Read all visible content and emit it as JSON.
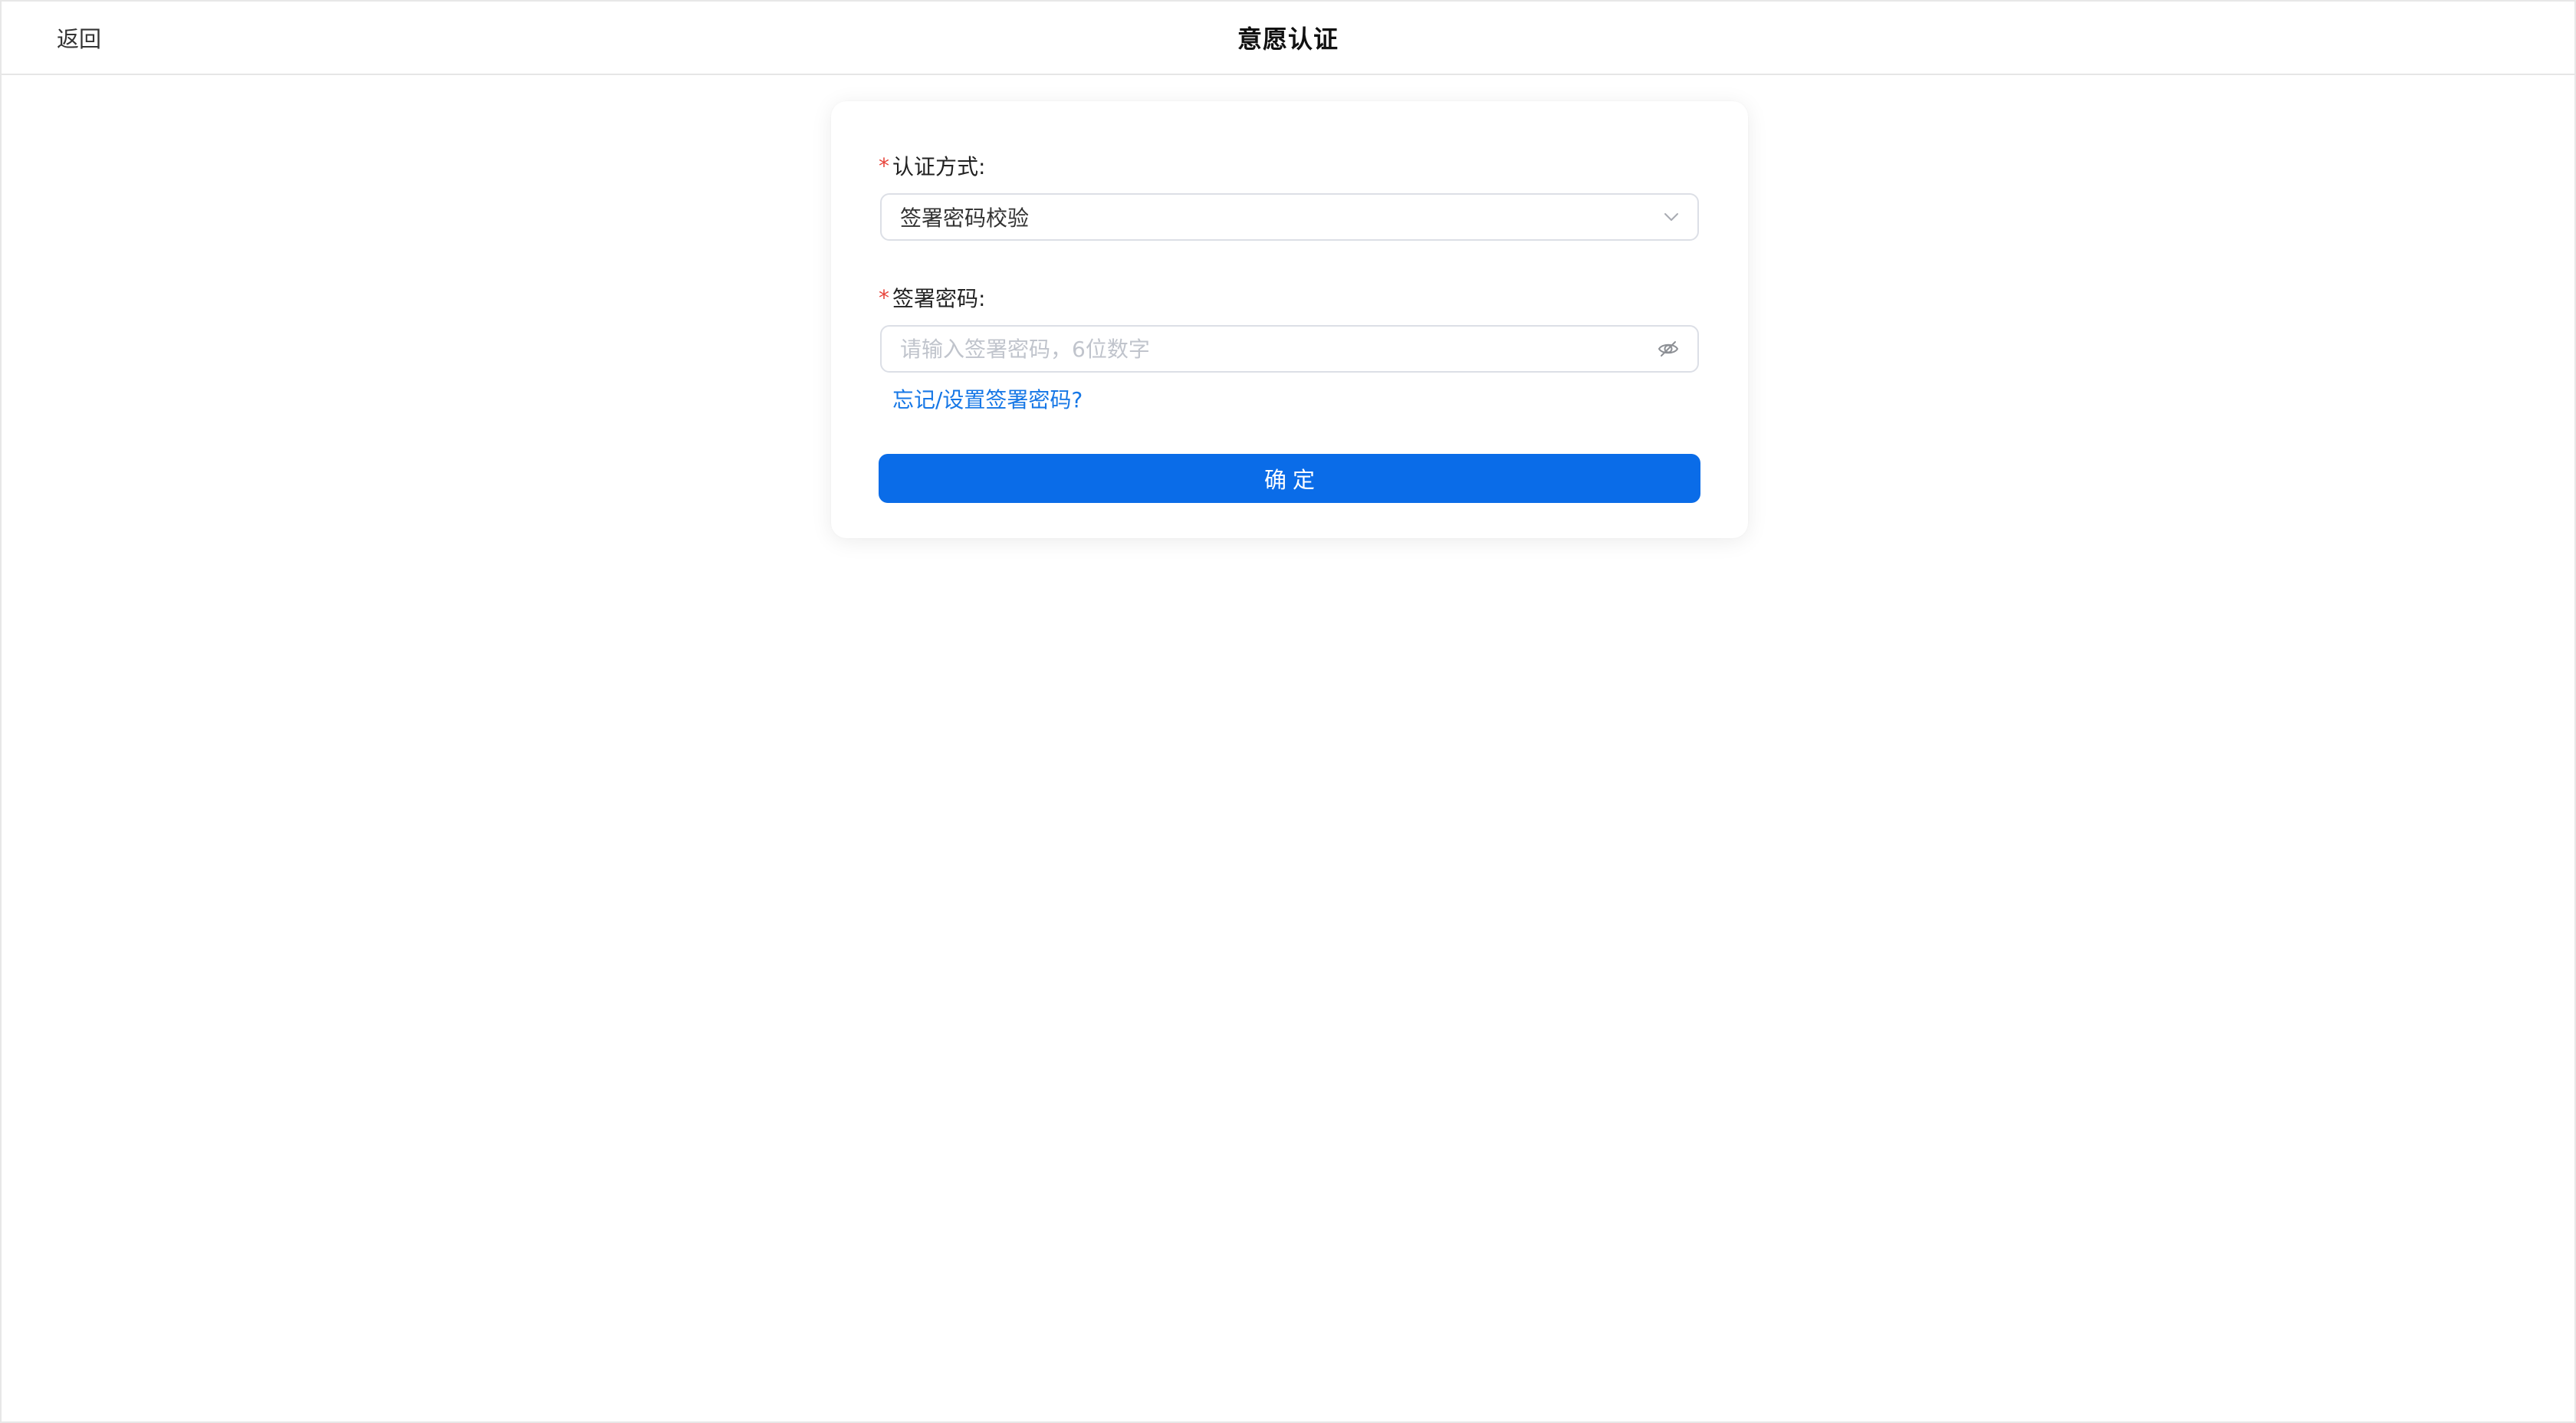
{
  "header": {
    "back_label": "返回",
    "title": "意愿认证"
  },
  "form": {
    "auth_method": {
      "required_mark": "*",
      "label": "认证方式:",
      "selected_value": "签署密码校验",
      "icon": "chevron-down-icon"
    },
    "sign_password": {
      "required_mark": "*",
      "label": "签署密码:",
      "value": "",
      "placeholder": "请输入签署密码，6位数字",
      "toggle_icon": "eye-off-icon"
    },
    "forgot_link": "忘记/设置签署密码?",
    "confirm_label": "确定"
  },
  "colors": {
    "primary": "#0a6ce8",
    "link": "#1677e6",
    "required": "#e8453c",
    "border": "#dcdfe6",
    "placeholder": "#c0c4cc"
  }
}
